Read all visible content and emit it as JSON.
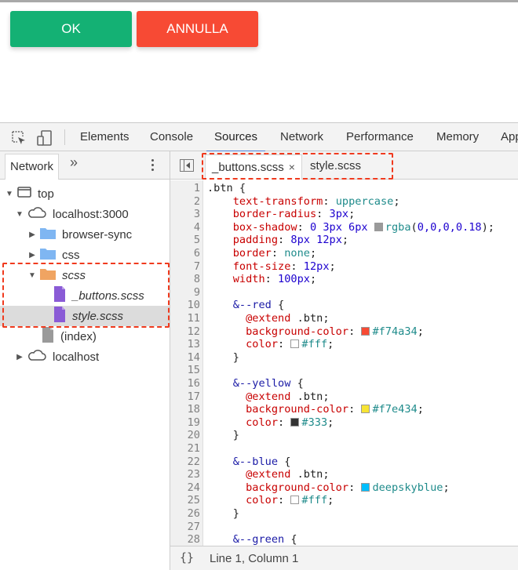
{
  "page": {
    "buttons": [
      {
        "label": "OK",
        "color": "#14b174"
      },
      {
        "label": "ANNULLA",
        "color": "#f74a34"
      }
    ]
  },
  "devtools": {
    "toolbar": {
      "icons": [
        "inspect-element-icon",
        "device-toolbar-icon"
      ],
      "tabs": [
        {
          "label": "Elements",
          "active": false
        },
        {
          "label": "Console",
          "active": false
        },
        {
          "label": "Sources",
          "active": true
        },
        {
          "label": "Network",
          "active": false
        },
        {
          "label": "Performance",
          "active": false
        },
        {
          "label": "Memory",
          "active": false
        },
        {
          "label": "App",
          "active": false
        }
      ],
      "active_color": "#4d7fd8"
    },
    "navigator": {
      "tab_label": "Network",
      "more_label": "»",
      "tree": [
        {
          "label": "top",
          "icon": "frame-icon",
          "expanded": true,
          "depth": 0
        },
        {
          "label": "localhost:3000",
          "icon": "cloud-icon",
          "expanded": true,
          "depth": 1
        },
        {
          "label": "browser-sync",
          "icon": "folder-icon",
          "expanded": false,
          "depth": 2
        },
        {
          "label": "css",
          "icon": "folder-icon",
          "expanded": false,
          "depth": 2
        },
        {
          "label": "scss",
          "icon": "folder-icon",
          "expanded": true,
          "depth": 2,
          "italic": true
        },
        {
          "label": "_buttons.scss",
          "icon": "file-icon",
          "depth": 3,
          "italic": true
        },
        {
          "label": "style.scss",
          "icon": "file-icon",
          "depth": 3,
          "italic": true,
          "selected": true
        },
        {
          "label": "(index)",
          "icon": "file-icon",
          "depth": 2
        },
        {
          "label": "localhost",
          "icon": "cloud-icon",
          "expanded": false,
          "depth": 1
        }
      ]
    },
    "editor": {
      "tabs": [
        {
          "label": "_buttons.scss",
          "active": true,
          "close": "×"
        },
        {
          "label": "style.scss",
          "active": false
        }
      ],
      "lines": [
        {
          "n": "1",
          "tokens": [
            [
              "c-sel",
              ".btn {"
            ]
          ]
        },
        {
          "n": "2",
          "tokens": [
            [
              "c-prop",
              "    text-transform"
            ],
            [
              "c-sel",
              ": "
            ],
            [
              "c-kw",
              "uppercase"
            ],
            [
              "c-sel",
              ";"
            ]
          ]
        },
        {
          "n": "3",
          "tokens": [
            [
              "c-prop",
              "    border-radius"
            ],
            [
              "c-sel",
              ": "
            ],
            [
              "c-num",
              "3px"
            ],
            [
              "c-sel",
              ";"
            ]
          ]
        },
        {
          "n": "4",
          "tokens": [
            [
              "c-prop",
              "    box-shadow"
            ],
            [
              "c-sel",
              ": "
            ],
            [
              "c-num",
              "0 3px 6px "
            ],
            [
              "swatch",
              "#9a9a9a"
            ],
            [
              "c-val",
              "rgba"
            ],
            [
              "c-sel",
              "("
            ],
            [
              "c-num",
              "0,0,0,0.18"
            ],
            [
              "c-sel",
              ");"
            ]
          ]
        },
        {
          "n": "5",
          "tokens": [
            [
              "c-prop",
              "    padding"
            ],
            [
              "c-sel",
              ": "
            ],
            [
              "c-num",
              "8px 12px"
            ],
            [
              "c-sel",
              ";"
            ]
          ]
        },
        {
          "n": "6",
          "tokens": [
            [
              "c-prop",
              "    border"
            ],
            [
              "c-sel",
              ": "
            ],
            [
              "c-kw",
              "none"
            ],
            [
              "c-sel",
              ";"
            ]
          ]
        },
        {
          "n": "7",
          "tokens": [
            [
              "c-prop",
              "    font-size"
            ],
            [
              "c-sel",
              ": "
            ],
            [
              "c-num",
              "12px"
            ],
            [
              "c-sel",
              ";"
            ]
          ]
        },
        {
          "n": "8",
          "tokens": [
            [
              "c-prop",
              "    width"
            ],
            [
              "c-sel",
              ": "
            ],
            [
              "c-num",
              "100px"
            ],
            [
              "c-sel",
              ";"
            ]
          ]
        },
        {
          "n": "9",
          "tokens": []
        },
        {
          "n": "10",
          "tokens": [
            [
              "c-nest",
              "    &--red"
            ],
            [
              "c-sel",
              " {"
            ]
          ]
        },
        {
          "n": "11",
          "tokens": [
            [
              "c-at",
              "      @extend"
            ],
            [
              "c-sel",
              " .btn;"
            ]
          ]
        },
        {
          "n": "12",
          "tokens": [
            [
              "c-prop",
              "      background-color"
            ],
            [
              "c-sel",
              ": "
            ],
            [
              "swatch",
              "#f74a34"
            ],
            [
              "c-val",
              "#f74a34"
            ],
            [
              "c-sel",
              ";"
            ]
          ]
        },
        {
          "n": "13",
          "tokens": [
            [
              "c-prop",
              "      color"
            ],
            [
              "c-sel",
              ": "
            ],
            [
              "swatch",
              "#ffffff"
            ],
            [
              "c-val",
              "#fff"
            ],
            [
              "c-sel",
              ";"
            ]
          ]
        },
        {
          "n": "14",
          "tokens": [
            [
              "c-sel",
              "    }"
            ]
          ]
        },
        {
          "n": "15",
          "tokens": []
        },
        {
          "n": "16",
          "tokens": [
            [
              "c-nest",
              "    &--yellow"
            ],
            [
              "c-sel",
              " {"
            ]
          ]
        },
        {
          "n": "17",
          "tokens": [
            [
              "c-at",
              "      @extend"
            ],
            [
              "c-sel",
              " .btn;"
            ]
          ]
        },
        {
          "n": "18",
          "tokens": [
            [
              "c-prop",
              "      background-color"
            ],
            [
              "c-sel",
              ": "
            ],
            [
              "swatch",
              "#f7e434"
            ],
            [
              "c-val",
              "#f7e434"
            ],
            [
              "c-sel",
              ";"
            ]
          ]
        },
        {
          "n": "19",
          "tokens": [
            [
              "c-prop",
              "      color"
            ],
            [
              "c-sel",
              ": "
            ],
            [
              "swatch",
              "#333333"
            ],
            [
              "c-val",
              "#333"
            ],
            [
              "c-sel",
              ";"
            ]
          ]
        },
        {
          "n": "20",
          "tokens": [
            [
              "c-sel",
              "    }"
            ]
          ]
        },
        {
          "n": "21",
          "tokens": []
        },
        {
          "n": "22",
          "tokens": [
            [
              "c-nest",
              "    &--blue"
            ],
            [
              "c-sel",
              " {"
            ]
          ]
        },
        {
          "n": "23",
          "tokens": [
            [
              "c-at",
              "      @extend"
            ],
            [
              "c-sel",
              " .btn;"
            ]
          ]
        },
        {
          "n": "24",
          "tokens": [
            [
              "c-prop",
              "      background-color"
            ],
            [
              "c-sel",
              ": "
            ],
            [
              "swatch",
              "#00bfff"
            ],
            [
              "c-val",
              "deepskyblue"
            ],
            [
              "c-sel",
              ";"
            ]
          ]
        },
        {
          "n": "25",
          "tokens": [
            [
              "c-prop",
              "      color"
            ],
            [
              "c-sel",
              ": "
            ],
            [
              "swatch",
              "#ffffff"
            ],
            [
              "c-val",
              "#fff"
            ],
            [
              "c-sel",
              ";"
            ]
          ]
        },
        {
          "n": "26",
          "tokens": [
            [
              "c-sel",
              "    }"
            ]
          ]
        },
        {
          "n": "27",
          "tokens": []
        },
        {
          "n": "28",
          "tokens": [
            [
              "c-nest",
              "    &--green"
            ],
            [
              "c-sel",
              " {"
            ]
          ]
        }
      ]
    },
    "status_bar": {
      "pretty_print": "{}",
      "cursor_position": "Line 1, Column 1"
    }
  }
}
